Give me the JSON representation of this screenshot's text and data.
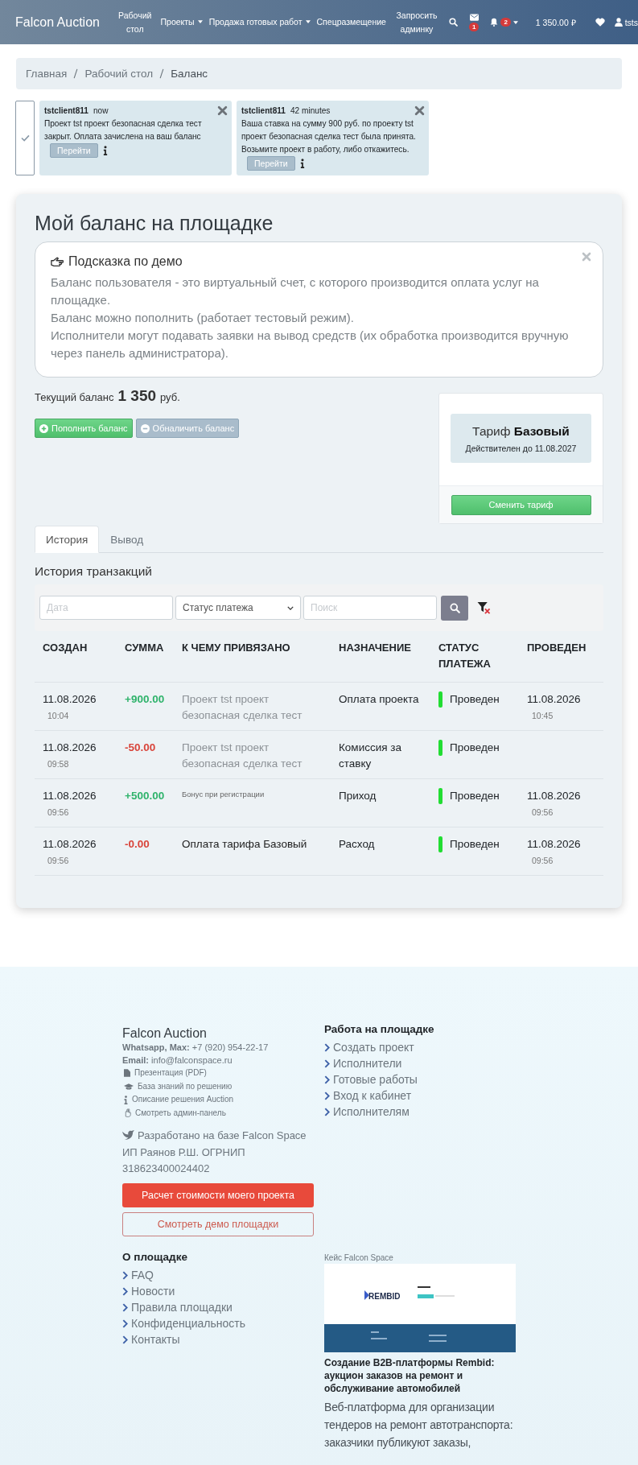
{
  "header": {
    "logo": "Falcon Auction",
    "nav": [
      {
        "label": "Рабочий стол",
        "dropdown": false,
        "wrap": true
      },
      {
        "label": "Проекты",
        "dropdown": true,
        "wrap": false
      },
      {
        "label": "Продажа готовых работ",
        "dropdown": true,
        "wrap": false
      },
      {
        "label": "Спецразмещение",
        "dropdown": false,
        "wrap": false
      },
      {
        "label": "Запросить админку",
        "dropdown": false,
        "wrap": true
      }
    ],
    "mail_badge": "1",
    "bell_badge": "2",
    "balance": "1 350.00 ₽",
    "user": "tsts"
  },
  "breadcrumb": [
    "Главная",
    "Рабочий стол",
    "Баланс"
  ],
  "notifications": [
    {
      "user": "tstclient811",
      "time": "now",
      "text": "Проект tst проект безопасная сделка тест закрыт. Оплата зачислена на ваш баланс",
      "button": "Перейти"
    },
    {
      "user": "tstclient811",
      "time": "42 minutes",
      "text": "Ваша ставка на сумму 900 руб. по проекту tst проект безопасная сделка тест была принята. Возьмите проект в работу, либо откажитесь.",
      "button": "Перейти"
    }
  ],
  "card": {
    "title": "Мой баланс на площадке",
    "hint": {
      "title": "Подсказка по демо",
      "lines": [
        "Баланс пользователя - это виртуальный счет, с которого производится оплата услуг на площадке.",
        "Баланс можно пополнить (работает тестовый режим).",
        "Исполнители могут подавать заявки на вывод средств (их обработка производится вручную через панель администратора)."
      ]
    },
    "balance": {
      "label": "Текущий баланс",
      "amount": "1 350",
      "currency": "руб."
    },
    "buttons": [
      {
        "label": "Пополнить баланс",
        "kind": "add"
      },
      {
        "label": "Обналичить баланс",
        "kind": "withdraw"
      }
    ],
    "tariff": {
      "label": "Тариф",
      "name": "Базовый",
      "valid": "Действителен до 11.08.2027",
      "button": "Сменить тариф"
    },
    "tabs": [
      {
        "label": "История",
        "selected": true
      },
      {
        "label": "Вывод",
        "selected": false
      }
    ],
    "section_title": "История транзакций",
    "filters": {
      "date_placeholder": "Дата",
      "status_value": "Статус платежа",
      "search_placeholder": "Поиск"
    },
    "table": {
      "columns": [
        "СОЗДАН",
        "СУММА",
        "К ЧЕМУ ПРИВЯЗАНО",
        "НАЗНАЧЕНИЕ",
        "СТАТУС ПЛАТЕЖА",
        "ПРОВЕДЕН"
      ],
      "rows": [
        {
          "created_date": "11.08.2026",
          "created_time": "10:04",
          "amount": "+900.00",
          "kind": "income",
          "linked": {
            "text": "Проект tst проект безопасная сделка тест",
            "kind": "link"
          },
          "purpose": "Оплата проекта",
          "status": "Проведен",
          "done_date": "11.08.2026",
          "done_time": "10:45"
        },
        {
          "created_date": "11.08.2026",
          "created_time": "09:58",
          "amount": "-50.00",
          "kind": "expense",
          "linked": {
            "text": "Проект tst проект безопасная сделка тест",
            "kind": "link"
          },
          "purpose": "Комиссия за ставку",
          "status": "Проведен"
        },
        {
          "created_date": "11.08.2026",
          "created_time": "09:56",
          "amount": "+500.00",
          "kind": "income",
          "linked": {
            "text": "Бонус при регистрации",
            "kind": "note"
          },
          "purpose": "Приход",
          "status": "Проведен",
          "done_date": "11.08.2026",
          "done_time": "09:56"
        },
        {
          "created_date": "11.08.2026",
          "created_time": "09:56",
          "amount": "-0.00",
          "kind": "expense",
          "linked": {
            "text": "Оплата тарифа Базовый",
            "kind": "plain"
          },
          "purpose": "Расход",
          "status": "Проведен",
          "done_date": "11.08.2026",
          "done_time": "09:56"
        }
      ]
    }
  },
  "footer": {
    "brand": "Falcon Auction",
    "contacts": [
      {
        "label": "Whatsapp, Max:",
        "value": "+7 (920) 954-22-17"
      },
      {
        "label": "Email:",
        "value": "info@falconspace.ru"
      }
    ],
    "resources": [
      {
        "label": "Презентация (PDF)",
        "kind": "pdf"
      },
      {
        "label": "База знаний по решению",
        "kind": "cap"
      },
      {
        "label": "Описание решения Auction",
        "kind": "info"
      },
      {
        "label": "Смотреть админ-панель",
        "kind": "hand"
      }
    ],
    "powered": "Разработано на базе Falcon Space",
    "company": "ИП Раянов Р.Ш. ОГРНИП 318623400024402",
    "primary_button": "Расчет стоимости моего проекта",
    "outline_button": "Смотреть демо площадки",
    "work": {
      "title": "Работа на площадке",
      "links": [
        "Создать проект",
        "Исполнители",
        "Готовые работы",
        "Вход к кабинет",
        "Исполнителям"
      ]
    },
    "about": {
      "title": "О площадке",
      "links": [
        "FAQ",
        "Новости",
        "Правила площадки",
        "Конфиденциальность",
        "Контакты"
      ]
    },
    "case": {
      "label": "Кейс Falcon Space",
      "logo": "REMBID",
      "title": "Создание B2B-платформы Rembid: аукцион заказов на ремонт и обслуживание автомобилей",
      "description": "Веб-платформа для организации тендеров на ремонт автотранспорта: заказчики публикуют заказы,"
    }
  }
}
